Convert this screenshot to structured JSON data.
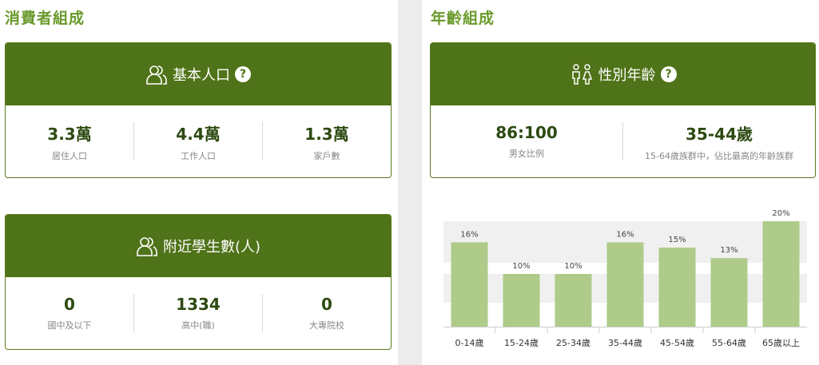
{
  "left": {
    "title": "消費者組成",
    "population": {
      "header": "基本人口",
      "help": "?",
      "stats": [
        {
          "value": "3.3萬",
          "label": "居住人口"
        },
        {
          "value": "4.4萬",
          "label": "工作人口"
        },
        {
          "value": "1.3萬",
          "label": "家戶數"
        }
      ]
    },
    "students": {
      "header": "附近學生數(人)",
      "stats": [
        {
          "value": "0",
          "label": "國中及以下"
        },
        {
          "value": "1334",
          "label": "高中(職)"
        },
        {
          "value": "0",
          "label": "大專院校"
        }
      ]
    }
  },
  "right": {
    "title": "年齡組成",
    "gender": {
      "header": "性別年齡",
      "help": "?",
      "stats": [
        {
          "value": "86:100",
          "label": "男女比例"
        },
        {
          "value": "35-44歲",
          "label": "15-64歲族群中，佔比最高的年齡族群"
        }
      ]
    }
  },
  "chart_data": {
    "type": "bar",
    "categories": [
      "0-14歲",
      "15-24歲",
      "25-34歲",
      "35-44歲",
      "45-54歲",
      "55-64歲",
      "65歲以上"
    ],
    "values": [
      16,
      10,
      10,
      16,
      15,
      13,
      20
    ],
    "data_labels": [
      "16%",
      "10%",
      "10%",
      "16%",
      "15%",
      "13%",
      "20%"
    ],
    "ylim": [
      0,
      20
    ],
    "bar_color": "#aecb8a",
    "grid": true
  },
  "colors": {
    "accent": "#4f7318",
    "title": "#6a9a2c",
    "value": "#2d4a12"
  }
}
